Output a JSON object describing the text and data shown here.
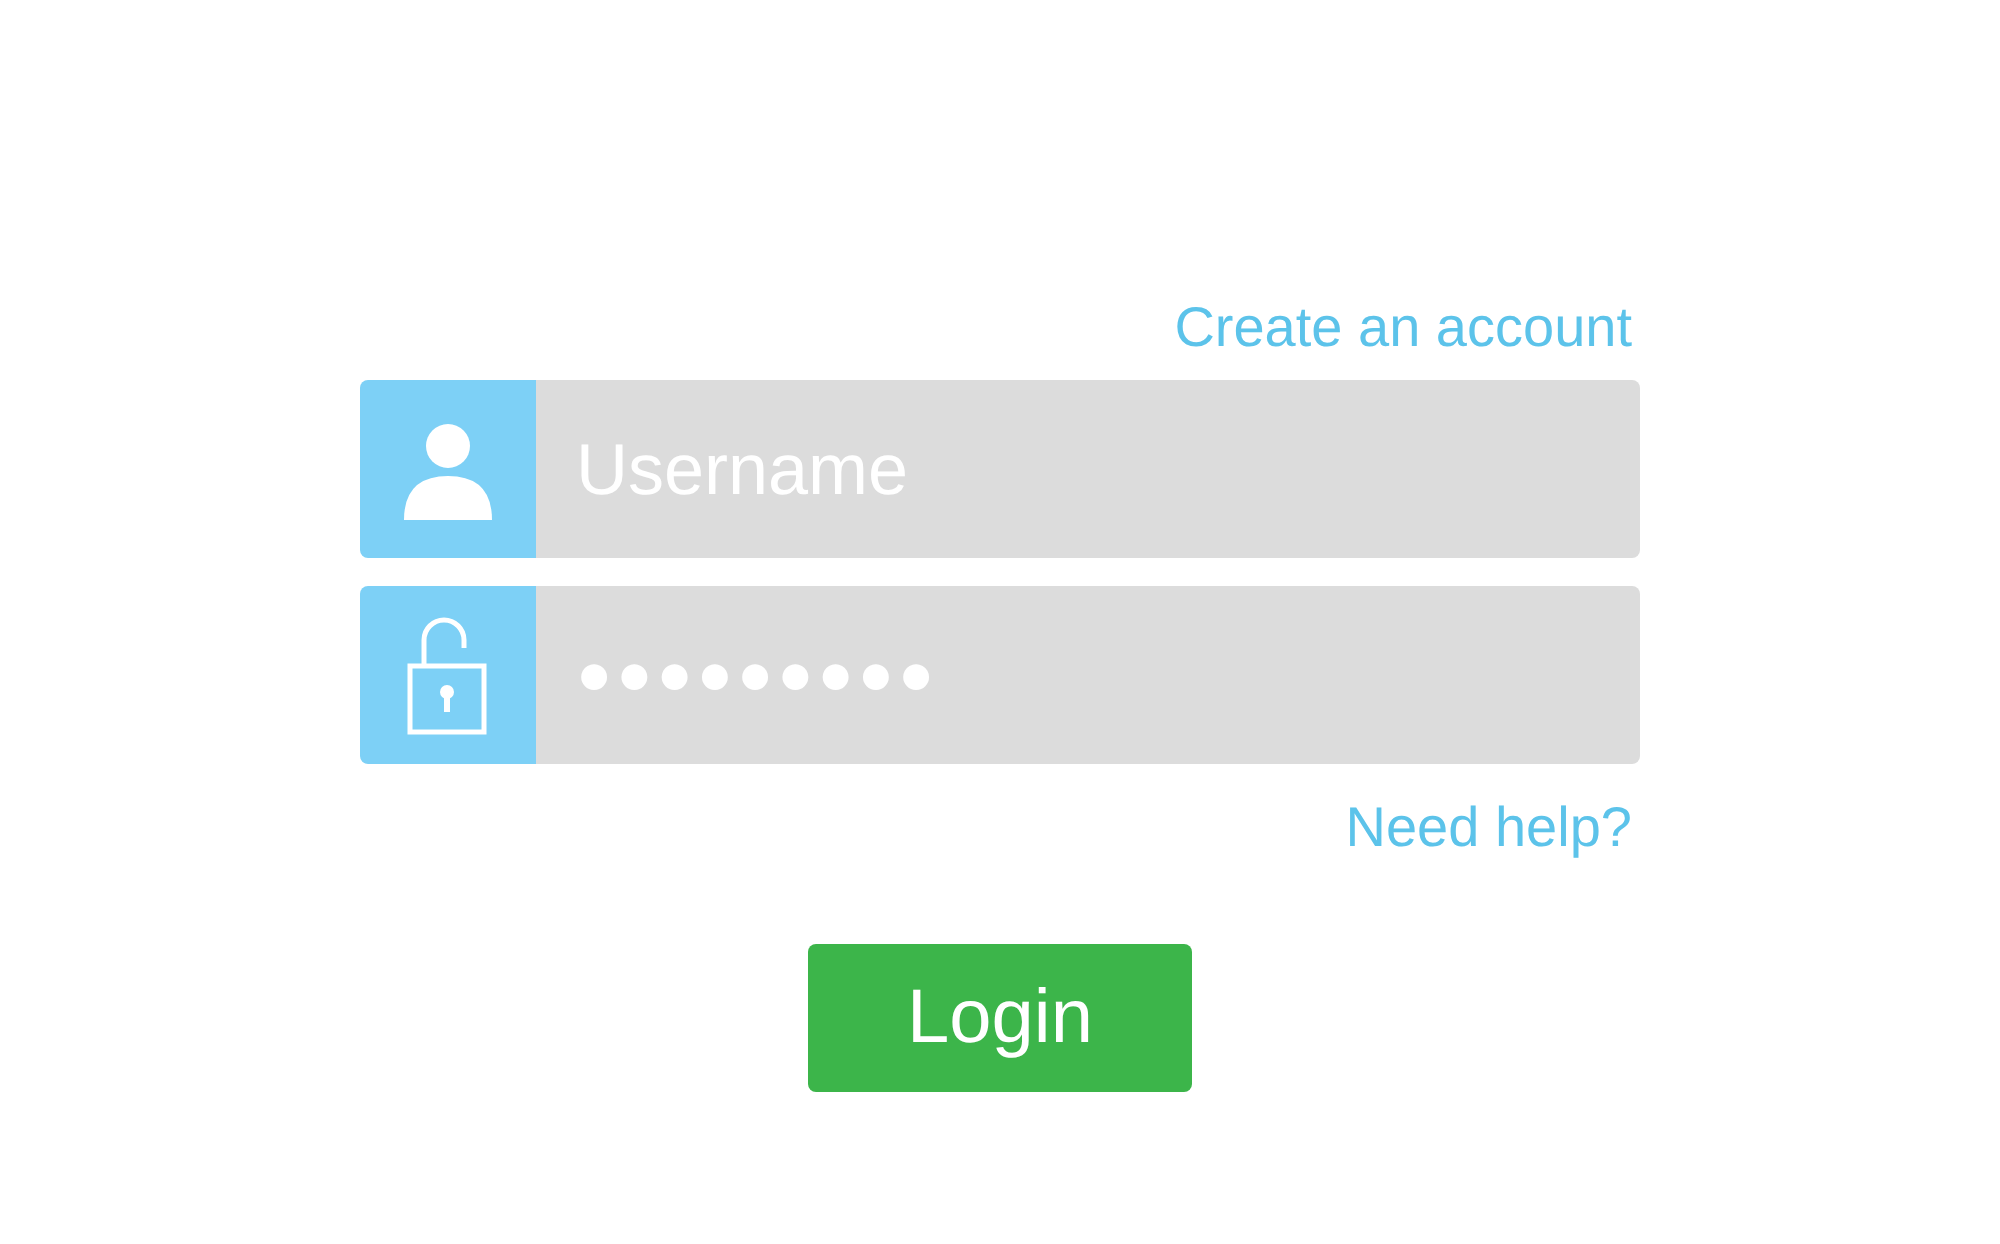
{
  "create_account_link": "Create an account",
  "username_field": {
    "placeholder": "Username"
  },
  "password_field": {
    "value": "●●●●●●●●●"
  },
  "help_link": "Need help?",
  "login_button": "Login"
}
